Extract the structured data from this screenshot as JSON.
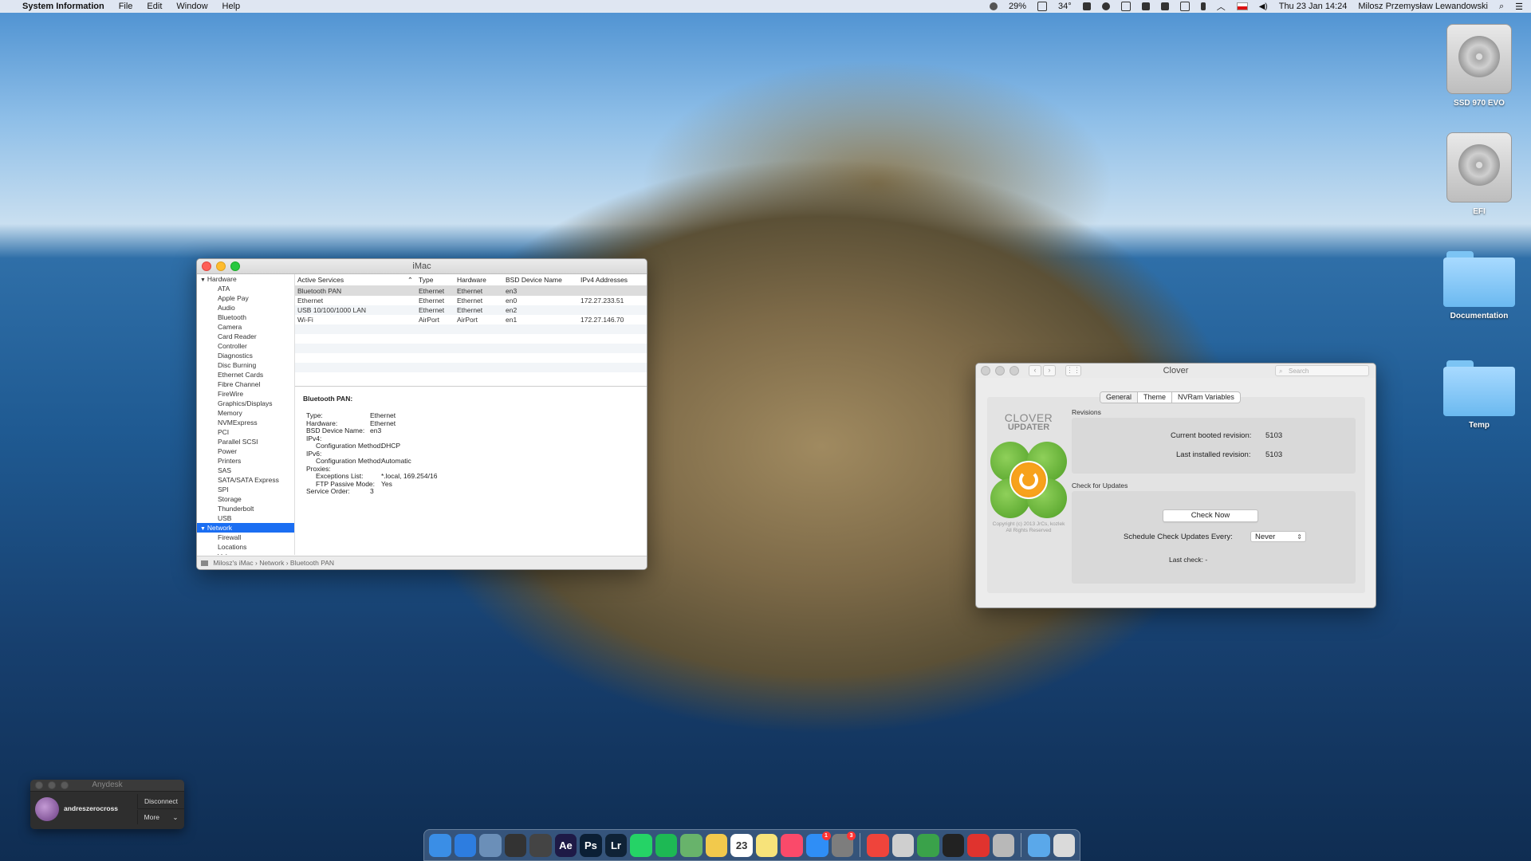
{
  "menubar": {
    "app_name": "System Information",
    "menus": [
      "File",
      "Edit",
      "Window",
      "Help"
    ],
    "battery": "29%",
    "temperature": "34°",
    "datetime": "Thu 23 Jan  14:24",
    "user": "Milosz Przemysław Lewandowski"
  },
  "desktop_icons": [
    {
      "label": "SSD 970 EVO"
    },
    {
      "label": "EFI"
    },
    {
      "label": "Documentation"
    },
    {
      "label": "Temp"
    }
  ],
  "sysinfo": {
    "title": "iMac",
    "sidebar": [
      {
        "label": "Hardware",
        "kind": "group"
      },
      {
        "label": "ATA"
      },
      {
        "label": "Apple Pay"
      },
      {
        "label": "Audio"
      },
      {
        "label": "Bluetooth"
      },
      {
        "label": "Camera"
      },
      {
        "label": "Card Reader"
      },
      {
        "label": "Controller"
      },
      {
        "label": "Diagnostics"
      },
      {
        "label": "Disc Burning"
      },
      {
        "label": "Ethernet Cards"
      },
      {
        "label": "Fibre Channel"
      },
      {
        "label": "FireWire"
      },
      {
        "label": "Graphics/Displays"
      },
      {
        "label": "Memory"
      },
      {
        "label": "NVMExpress"
      },
      {
        "label": "PCI"
      },
      {
        "label": "Parallel SCSI"
      },
      {
        "label": "Power"
      },
      {
        "label": "Printers"
      },
      {
        "label": "SAS"
      },
      {
        "label": "SATA/SATA Express"
      },
      {
        "label": "SPI"
      },
      {
        "label": "Storage"
      },
      {
        "label": "Thunderbolt"
      },
      {
        "label": "USB"
      },
      {
        "label": "Network",
        "kind": "group",
        "selected": true
      },
      {
        "label": "Firewall"
      },
      {
        "label": "Locations"
      },
      {
        "label": "Volumes"
      }
    ],
    "columns": [
      "Active Services",
      "Type",
      "Hardware",
      "BSD Device Name",
      "IPv4 Addresses"
    ],
    "rows": [
      [
        "Bluetooth PAN",
        "Ethernet",
        "Ethernet",
        "en3",
        ""
      ],
      [
        "Ethernet",
        "Ethernet",
        "Ethernet",
        "en0",
        "172.27.233.51"
      ],
      [
        "USB 10/100/1000 LAN",
        "Ethernet",
        "Ethernet",
        "en2",
        ""
      ],
      [
        "Wi-Fi",
        "AirPort",
        "AirPort",
        "en1",
        "172.27.146.70"
      ]
    ],
    "detail_title": "Bluetooth PAN:",
    "details": [
      {
        "k": "Type:",
        "v": "Ethernet",
        "indent": 0
      },
      {
        "k": "Hardware:",
        "v": "Ethernet",
        "indent": 0
      },
      {
        "k": "BSD Device Name:",
        "v": "en3",
        "indent": 0
      },
      {
        "k": "IPv4:",
        "v": "",
        "indent": 0
      },
      {
        "k": "Configuration Method:",
        "v": "DHCP",
        "indent": 1
      },
      {
        "k": "IPv6:",
        "v": "",
        "indent": 0
      },
      {
        "k": "Configuration Method:",
        "v": "Automatic",
        "indent": 1
      },
      {
        "k": "Proxies:",
        "v": "",
        "indent": 0
      },
      {
        "k": "Exceptions List:",
        "v": "*.local, 169.254/16",
        "indent": 1
      },
      {
        "k": "FTP Passive Mode:",
        "v": "Yes",
        "indent": 1
      },
      {
        "k": "Service Order:",
        "v": "3",
        "indent": 0
      }
    ],
    "path": "Milosz's iMac  ›  Network  ›  Bluetooth PAN"
  },
  "clover": {
    "title": "Clover",
    "search_placeholder": "Search",
    "tabs": [
      "General",
      "Theme",
      "NVRam Variables"
    ],
    "logo_line1": "CLOVER",
    "logo_line2": "UPDATER",
    "copyright": "Copyright (c) 2013 JrCs, kozlek\nAll Rights Reserved",
    "revisions_label": "Revisions",
    "booted_label": "Current booted revision:",
    "booted_value": "5103",
    "installed_label": "Last installed revision:",
    "installed_value": "5103",
    "check_label": "Check for Updates",
    "check_button": "Check Now",
    "schedule_label": "Schedule Check Updates Every:",
    "schedule_value": "Never",
    "last_check": "Last check: -"
  },
  "anydesk": {
    "title": "Anydesk",
    "user": "andreszerocross",
    "disconnect": "Disconnect",
    "more": "More"
  },
  "dock": {
    "apps": [
      {
        "name": "finder-icon",
        "color": "#3a8ee6",
        "text": ""
      },
      {
        "name": "safari-icon",
        "color": "#2d7de0",
        "text": ""
      },
      {
        "name": "preview-icon",
        "color": "#6b8fb8",
        "text": ""
      },
      {
        "name": "davinci-resolve-icon",
        "color": "#333",
        "text": ""
      },
      {
        "name": "final-cut-icon",
        "color": "#444",
        "text": ""
      },
      {
        "name": "after-effects-icon",
        "color": "#1e1a46",
        "text": "Ae"
      },
      {
        "name": "photoshop-icon",
        "color": "#0b1f35",
        "text": "Ps"
      },
      {
        "name": "lightroom-icon",
        "color": "#0f2236",
        "text": "Lr"
      },
      {
        "name": "whatsapp-icon",
        "color": "#25d366",
        "text": ""
      },
      {
        "name": "spotify-icon",
        "color": "#1db954",
        "text": ""
      },
      {
        "name": "maps-icon",
        "color": "#68b36b",
        "text": ""
      },
      {
        "name": "photos-icon",
        "color": "#f2c94c",
        "text": ""
      },
      {
        "name": "calendar-icon",
        "color": "#ffffff",
        "text": "23"
      },
      {
        "name": "notes-icon",
        "color": "#f7e37a",
        "text": ""
      },
      {
        "name": "music-icon",
        "color": "#fa4a6a",
        "text": ""
      },
      {
        "name": "app-store-icon",
        "color": "#2f8ef6",
        "text": "",
        "badge": "1"
      },
      {
        "name": "system-preferences-icon",
        "color": "#7d7d7d",
        "text": "",
        "badge": "3"
      },
      {
        "name": "anydesk-icon",
        "color": "#ef443b",
        "text": ""
      },
      {
        "name": "tools-icon",
        "color": "#cfcfcf",
        "text": ""
      },
      {
        "name": "globe-icon",
        "color": "#3aa24a",
        "text": ""
      },
      {
        "name": "terminal-icon",
        "color": "#222",
        "text": ""
      },
      {
        "name": "anydesk-session-icon",
        "color": "#e0332e",
        "text": ""
      },
      {
        "name": "automator-icon",
        "color": "#b8b8b8",
        "text": ""
      },
      {
        "name": "downloads-folder-icon",
        "color": "#5aa8ea",
        "text": ""
      },
      {
        "name": "trash-icon",
        "color": "#dadada",
        "text": ""
      }
    ]
  }
}
